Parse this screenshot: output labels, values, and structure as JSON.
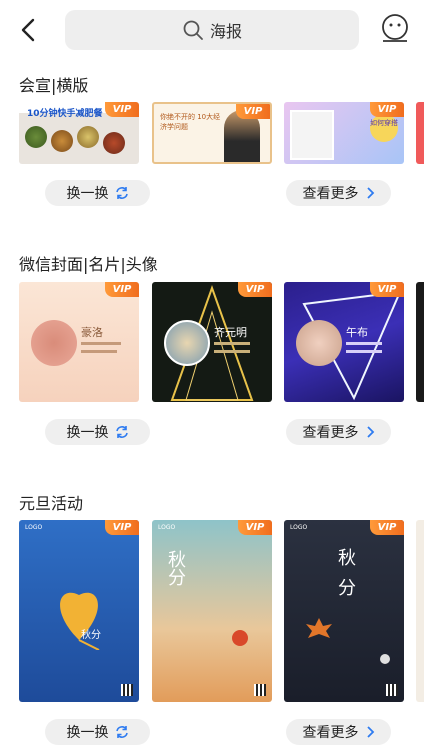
{
  "header": {
    "search_query": "海报",
    "icons": [
      "chevron-left-icon",
      "search-icon",
      "smiley-icon"
    ]
  },
  "sections": [
    {
      "title": "会宣|横版",
      "cards": [
        {
          "badge": "VIP",
          "text": "10分钟快手减肥餐"
        },
        {
          "badge": "VIP",
          "text": "你绝不开的 10大经济学问题"
        },
        {
          "badge": "VIP",
          "text": "如何穿搭"
        }
      ],
      "left_button": "换一换",
      "right_button": "查看更多"
    },
    {
      "title": "微信封面|名片|头像",
      "cards": [
        {
          "badge": "VIP",
          "name": "豪洛"
        },
        {
          "badge": "VIP",
          "name": "齐元明"
        },
        {
          "badge": "VIP",
          "name": "午布"
        }
      ],
      "left_button": "换一换",
      "right_button": "查看更多"
    },
    {
      "title": "元旦活动",
      "cards": [
        {
          "badge": "VIP",
          "logo": "LOGO",
          "text": "秋分"
        },
        {
          "badge": "VIP",
          "logo": "LOGO",
          "text": "秋分"
        },
        {
          "badge": "VIP",
          "logo": "LOGO",
          "text": "秋分"
        }
      ],
      "left_button": "换一换",
      "right_button": "查看更多"
    }
  ],
  "colors": {
    "accent": "#2e7bf0",
    "badge": "#f07a25",
    "pill_bg": "#efefef"
  }
}
